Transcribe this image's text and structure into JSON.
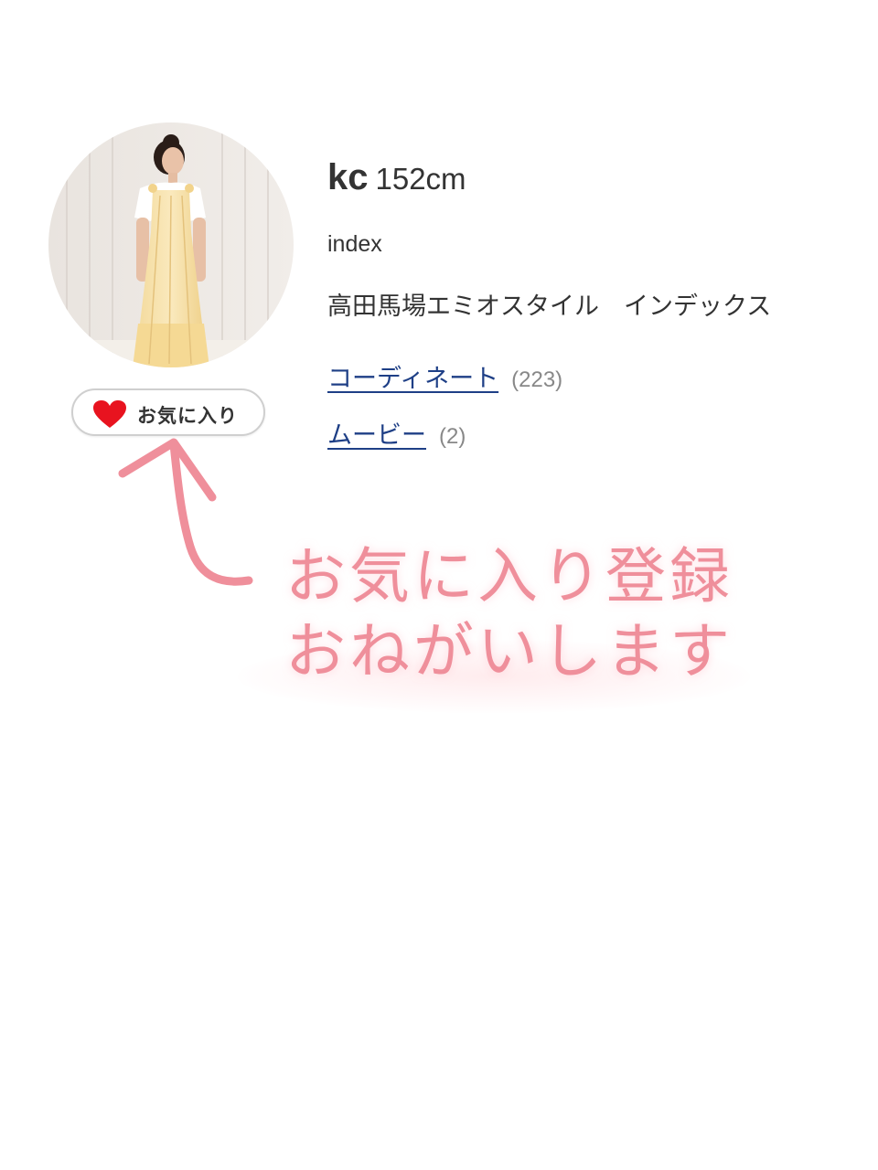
{
  "profile": {
    "name": "kc",
    "height": "152cm",
    "brand": "index",
    "shop": "高田馬場エミオスタイル　インデックス",
    "avatar_alt": "profile-photo"
  },
  "favorite_button": {
    "label": "お気に入り",
    "icon": "heart-icon"
  },
  "links": [
    {
      "label": "コーディネート",
      "count": "(223)"
    },
    {
      "label": "ムービー",
      "count": "(2)"
    }
  ],
  "annotation": {
    "line1": "お気に入り登録",
    "line2": "おねがいします",
    "color": "#ef8f9b"
  },
  "colors": {
    "link": "#1e3f86",
    "heart": "#e8131f",
    "count": "#888888"
  }
}
